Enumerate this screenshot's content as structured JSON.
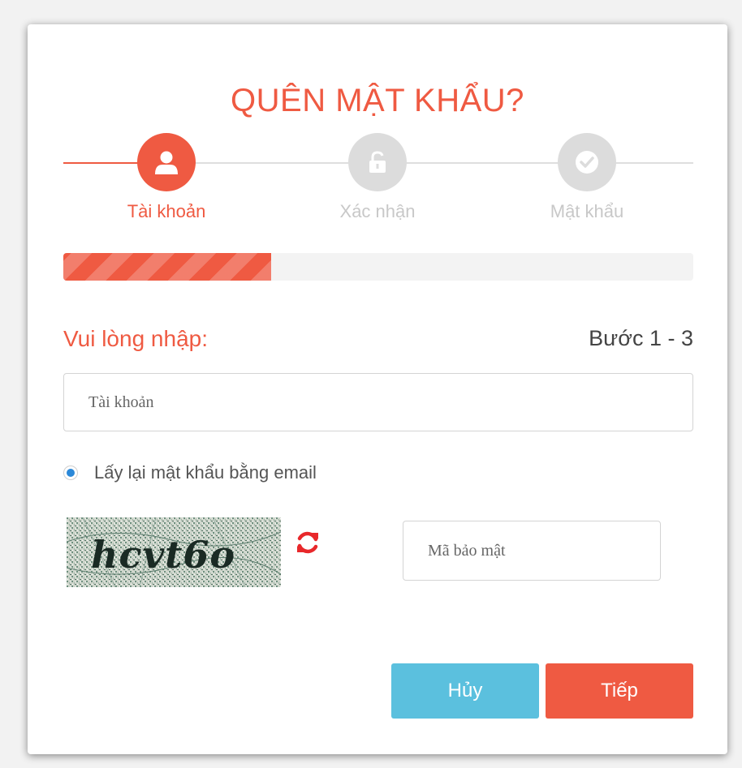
{
  "dialog": {
    "title": "QUÊN MẬT KHẨU?"
  },
  "steps": [
    {
      "label": "Tài khoản",
      "icon": "user-icon",
      "state": "active"
    },
    {
      "label": "Xác nhận",
      "icon": "unlock-icon",
      "state": "inactive"
    },
    {
      "label": "Mật khẩu",
      "icon": "check-icon",
      "state": "inactive"
    }
  ],
  "progress": {
    "fraction": 0.33
  },
  "form": {
    "prompt": "Vui lòng nhập:",
    "step_indicator": "Bước 1 - 3",
    "account_placeholder": "Tài khoản",
    "radio_label": "Lấy lại mật khẩu bằng email",
    "radio_selected": true,
    "captcha_text": "hcvt6o",
    "refresh_icon": "refresh-icon",
    "code_placeholder": "Mã bảo mật"
  },
  "buttons": {
    "cancel": "Hủy",
    "next": "Tiếp"
  },
  "colors": {
    "accent": "#ef5a42",
    "cancel": "#5bc0de",
    "inactive": "#dcdcdc",
    "radio": "#2b88d8"
  }
}
